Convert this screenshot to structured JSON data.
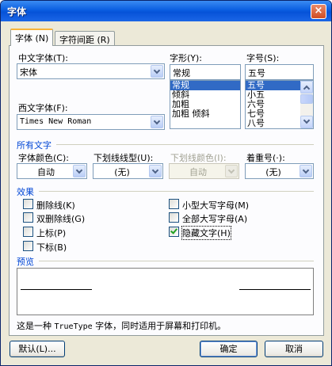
{
  "window": {
    "title": "字体",
    "close_glyph": "×"
  },
  "tabs": [
    {
      "label": "字体 (N)",
      "active": true
    },
    {
      "label": "字符间距 (R)",
      "active": false
    }
  ],
  "fields": {
    "chinese_font": {
      "label": "中文字体(T):",
      "value": "宋体"
    },
    "western_font": {
      "label": "西文字体(F):",
      "value": "Times New Roman"
    },
    "style": {
      "label": "字形(Y):",
      "value": "常规",
      "options": [
        "常规",
        "倾斜",
        "加粗",
        "加粗 倾斜"
      ],
      "selected": "常规"
    },
    "size": {
      "label": "字号(S):",
      "value": "五号",
      "options": [
        "五号",
        "小五",
        "六号",
        "七号",
        "八号"
      ],
      "selected": "五号"
    }
  },
  "all_text": {
    "heading": "所有文字",
    "font_color": {
      "label": "字体颜色(C):",
      "value": "自动"
    },
    "underline_style": {
      "label": "下划线线型(U):",
      "value": "(无)"
    },
    "underline_color": {
      "label": "下划线颜色(I):",
      "value": "自动",
      "disabled": true
    },
    "emphasis_mark": {
      "label": "着重号(·):",
      "value": "(无)"
    }
  },
  "effects": {
    "heading": "效果",
    "items": [
      {
        "label": "删除线(K)",
        "checked": false
      },
      {
        "label": "双删除线(G)",
        "checked": false
      },
      {
        "label": "上标(P)",
        "checked": false
      },
      {
        "label": "下标(B)",
        "checked": false
      },
      {
        "label": "小型大写字母(M)",
        "checked": false
      },
      {
        "label": "全部大写字母(A)",
        "checked": false
      },
      {
        "label": "隐藏文字(H)",
        "checked": true
      }
    ]
  },
  "preview": {
    "heading": "预览"
  },
  "footnote": {
    "prefix": "这是一种",
    "font_type": "TrueType",
    "suffix": "字体，同时适用于屏幕和打印机。"
  },
  "buttons": {
    "default": "默认(L)...",
    "ok": "确定",
    "cancel": "取消"
  }
}
